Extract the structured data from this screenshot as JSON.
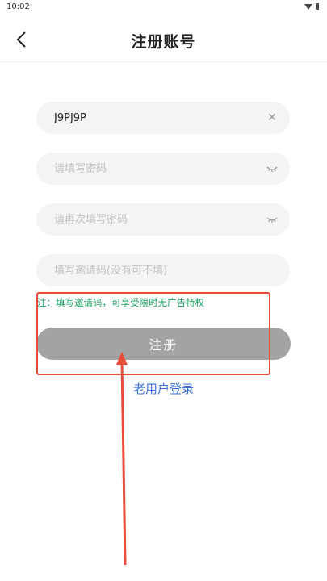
{
  "status_bar": {
    "time": "10:02"
  },
  "header": {
    "title": "注册账号",
    "back_icon": "chevron-left-icon"
  },
  "form": {
    "account": {
      "value": "J9PJ9P",
      "clear_icon": "close-icon"
    },
    "password": {
      "placeholder": "请填写密码",
      "toggle_icon": "eye-closed-icon"
    },
    "confirm_password": {
      "placeholder": "请再次填写密码",
      "toggle_icon": "eye-closed-icon"
    },
    "invite_code": {
      "placeholder": "填写邀请码(没有可不填)"
    }
  },
  "note": "注：填写邀请码，可享受限时无广告特权",
  "register_button": "注册",
  "old_user_login": "老用户登录",
  "colors": {
    "accent_link": "#3a6fd8",
    "note_green": "#1aa260",
    "button_gray": "#a3a3a3",
    "annotation_red": "#e74c3c"
  }
}
